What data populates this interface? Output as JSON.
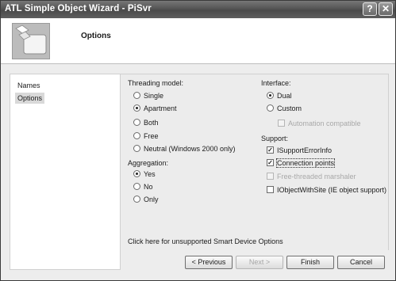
{
  "window": {
    "title": "ATL Simple Object Wizard - PiSvr",
    "help_glyph": "?",
    "close_glyph": "✕"
  },
  "header": {
    "heading": "Options"
  },
  "sidebar": {
    "items": [
      {
        "label": "Names",
        "selected": false
      },
      {
        "label": "Options",
        "selected": true
      }
    ]
  },
  "threading": {
    "label": "Threading model:",
    "options": [
      {
        "label": "Single",
        "selected": false
      },
      {
        "label": "Apartment",
        "selected": true
      },
      {
        "label": "Both",
        "selected": false
      },
      {
        "label": "Free",
        "selected": false
      },
      {
        "label": "Neutral (Windows 2000 only)",
        "selected": false
      }
    ]
  },
  "aggregation": {
    "label": "Aggregation:",
    "options": [
      {
        "label": "Yes",
        "selected": true
      },
      {
        "label": "No",
        "selected": false
      },
      {
        "label": "Only",
        "selected": false
      }
    ]
  },
  "interface": {
    "label": "Interface:",
    "options": [
      {
        "label": "Dual",
        "selected": true
      },
      {
        "label": "Custom",
        "selected": false
      }
    ],
    "automation_label": "Automation compatible"
  },
  "support": {
    "label": "Support:",
    "items": [
      {
        "label": "ISupportErrorInfo",
        "checked": true,
        "enabled": true
      },
      {
        "label": "Connection points",
        "checked": true,
        "enabled": true
      },
      {
        "label": "Free-threaded marshaler",
        "checked": false,
        "enabled": false
      },
      {
        "label": "IObjectWithSite (IE object support)",
        "checked": false,
        "enabled": true
      }
    ]
  },
  "smart_device_link": "Click here for unsupported Smart Device Options",
  "buttons": {
    "previous": "< Previous",
    "next": "Next >",
    "finish": "Finish",
    "cancel": "Cancel"
  }
}
